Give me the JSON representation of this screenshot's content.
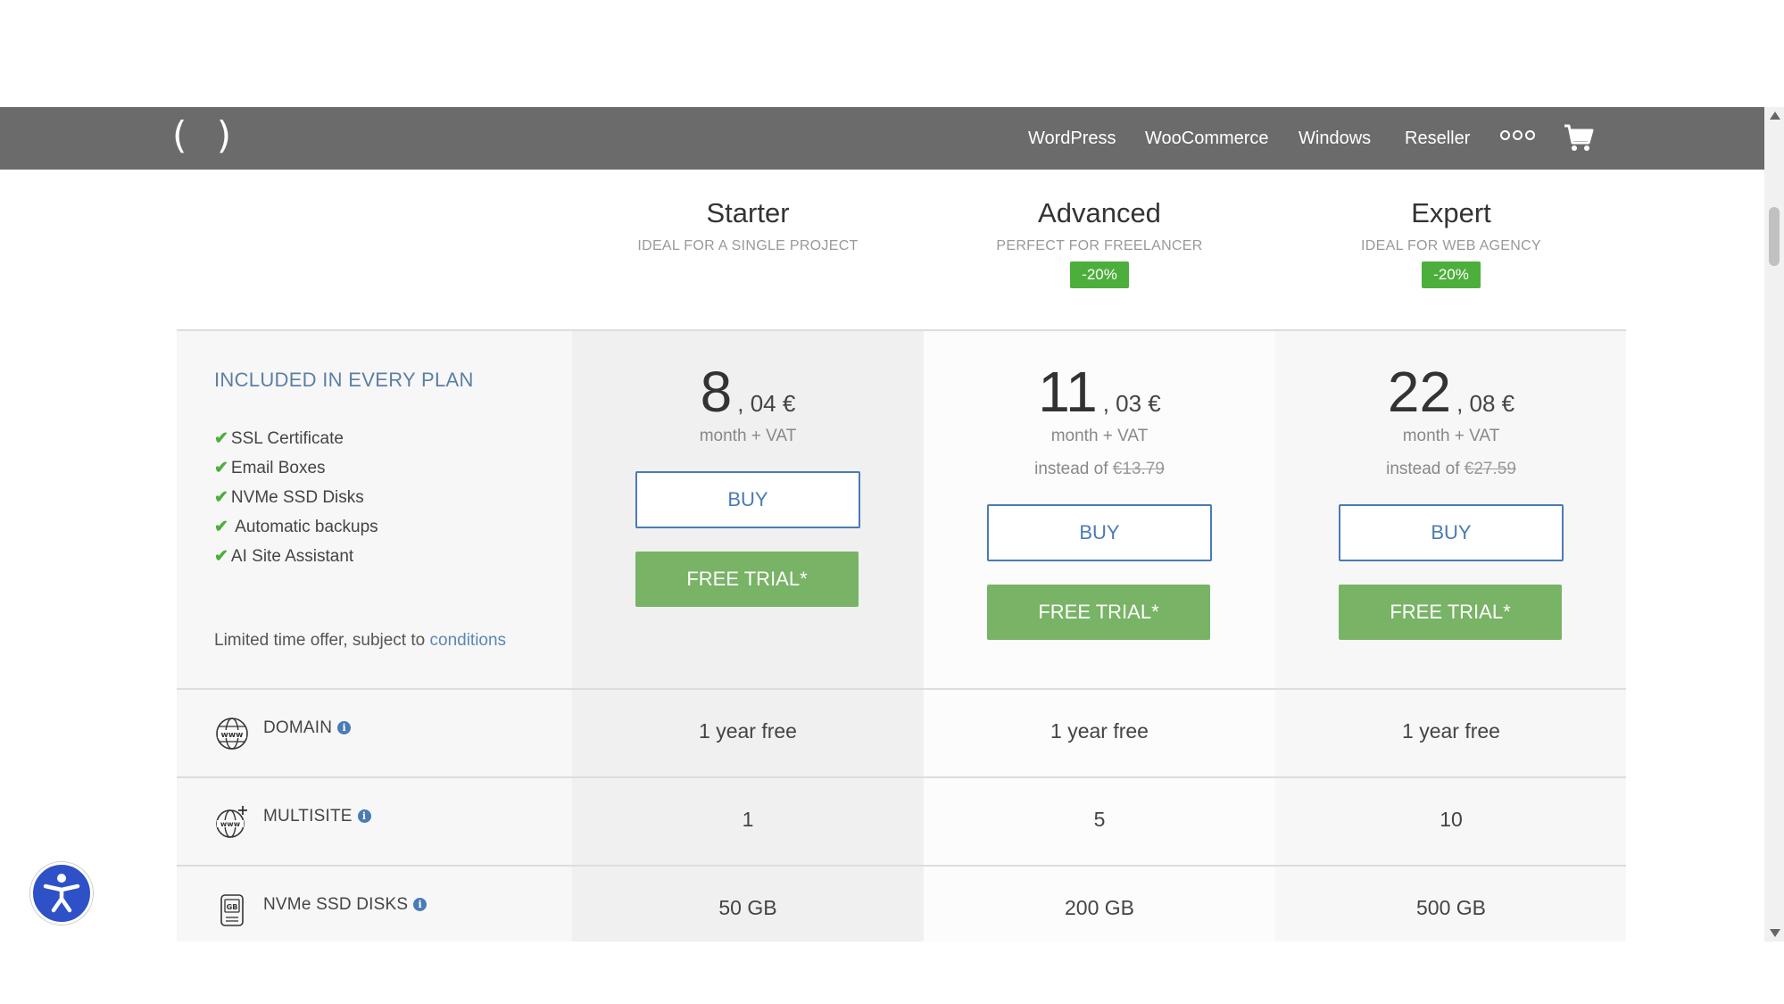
{
  "nav": {
    "logo": "( )",
    "items": [
      "WordPress",
      "WooCommerce",
      "Windows",
      "Reseller"
    ],
    "more_icon": "more-icon",
    "cart_icon": "cart-icon"
  },
  "plans": [
    {
      "name": "Starter",
      "tagline": "IDEAL FOR A SINGLE PROJECT",
      "badge": "",
      "price_int": "8",
      "price_dec": ", 04 €",
      "period": "month + VAT",
      "instead_label": "",
      "instead_price": "",
      "buy": "BUY",
      "trial": "FREE TRIAL*"
    },
    {
      "name": "Advanced",
      "tagline": "PERFECT FOR FREELANCER",
      "badge": "-20%",
      "price_int": "11",
      "price_dec": ", 03 €",
      "period": "month + VAT",
      "instead_label": "instead of",
      "instead_price": "€13.79",
      "buy": "BUY",
      "trial": "FREE TRIAL*"
    },
    {
      "name": "Expert",
      "tagline": "IDEAL FOR WEB AGENCY",
      "badge": "-20%",
      "price_int": "22",
      "price_dec": ", 08 €",
      "period": "month + VAT",
      "instead_label": "instead of",
      "instead_price": "€27.59",
      "buy": "BUY",
      "trial": "FREE TRIAL*"
    }
  ],
  "included": {
    "title": "INCLUDED IN EVERY PLAN",
    "features": [
      "SSL Certificate",
      "Email Boxes",
      "NVMe SSD Disks",
      " Automatic backups",
      "AI Site Assistant"
    ],
    "limited_text": "Limited time offer, subject to",
    "conditions_link": "conditions"
  },
  "rows": [
    {
      "label": "DOMAIN",
      "icon": "globe-www-icon",
      "values": [
        "1 year free",
        "1 year free",
        "1 year free"
      ]
    },
    {
      "label": "MULTISITE",
      "icon": "globe-plus-icon",
      "values": [
        "1",
        "5",
        "10"
      ]
    },
    {
      "label": "NVMe SSD DISKS",
      "icon": "disk-gb-icon",
      "values": [
        "50 GB",
        "200 GB",
        "500 GB"
      ]
    }
  ],
  "info_glyph": "i",
  "colors": {
    "nav_bg": "#6b6b6b",
    "accent_green": "#4caf3c",
    "trial_green": "#78b366",
    "buy_blue": "#4a7bb5",
    "accessibility_blue": "#2f51c7"
  }
}
